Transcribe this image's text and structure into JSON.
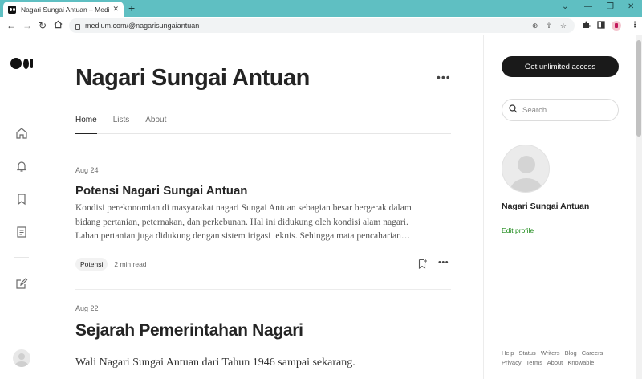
{
  "browser": {
    "tab_title": "Nagari Sungai Antuan – Medium",
    "tab_close": "✕",
    "new_tab": "+",
    "url": "medium.com/@nagarisungaiantuan",
    "icons": [
      "back-icon",
      "forward-icon",
      "reload-icon",
      "home-icon",
      "lock-icon",
      "zoom-icon",
      "share-icon",
      "star-icon",
      "extensions-icon",
      "sidebar-icon",
      "profile-icon",
      "menu-icon"
    ]
  },
  "profile": {
    "title": "Nagari Sungai Antuan",
    "more": "•••",
    "tabs": [
      {
        "label": "Home",
        "active": true
      },
      {
        "label": "Lists",
        "active": false
      },
      {
        "label": "About",
        "active": false
      }
    ]
  },
  "articles": [
    {
      "date": "Aug 24",
      "title": "Potensi Nagari Sungai Antuan",
      "excerpt": [
        "Kondisi perekonomian di masyarakat nagari Sungai Antuan sebagian besar bergerak dalam",
        "bidang pertanian, peternakan, dan perkebunan. Hal ini didukung oleh kondisi alam nagari.",
        "Lahan pertanian juga didukung dengan sistem irigasi teknis. Sehingga mata pencaharian…"
      ],
      "tag": "Potensi",
      "read_time": "2 min read",
      "more": "•••"
    },
    {
      "date": "Aug 22",
      "title": "Sejarah Pemerintahan Nagari",
      "excerpt": [
        "Wali Nagari Sungai Antuan dari Tahun 1946 sampai sekarang."
      ]
    }
  ],
  "sidebar": {
    "cta": "Get unlimited access",
    "search_placeholder": "Search",
    "name": "Nagari Sungai Antuan",
    "edit_profile": "Edit profile",
    "footer_row1": [
      "Help",
      "Status",
      "Writers",
      "Blog",
      "Careers"
    ],
    "footer_row2": [
      "Privacy",
      "Terms",
      "About",
      "Knowable"
    ]
  },
  "colors": {
    "tabbar": "#5fbfc2",
    "cta_bg": "#1a1a1a",
    "edit_profile": "#1a8917"
  }
}
